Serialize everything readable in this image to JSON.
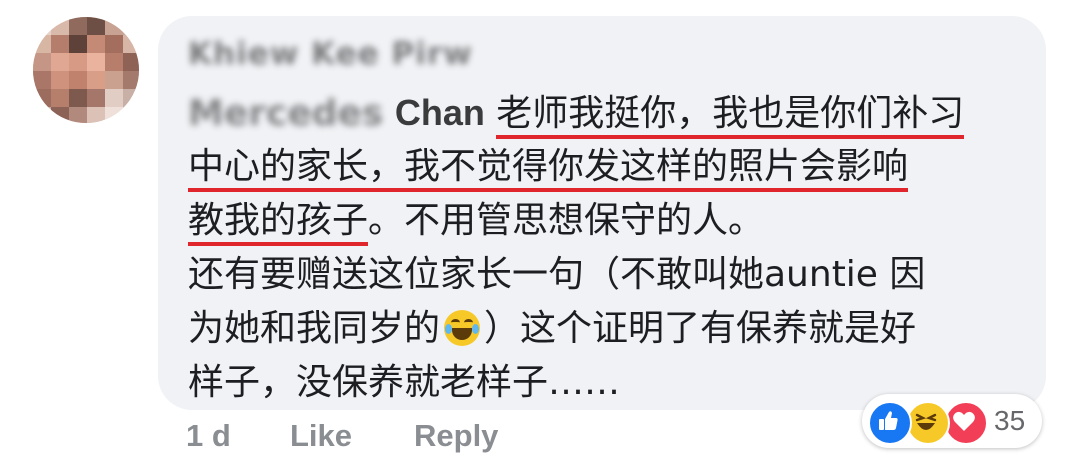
{
  "comment": {
    "author_name": "Khiew Kee Pirw",
    "mention_blurred": "Mercedes",
    "mention_name": "Chan",
    "lines": [
      {
        "underlined": "老师我挺你，我也是你们补习"
      },
      {
        "underlined": "中心的家长，我不觉得你发这样的照片会影响"
      },
      {
        "underlined": "教我的孩子",
        "plain": "。不用管思想保守的人。"
      },
      {
        "plain": "还有要赠送这位家长一句（不敢叫她auntie 因"
      },
      {
        "before": "为她和我同岁的",
        "after": "）这个证明了有保养就是好"
      },
      {
        "plain": "样子，没保养就老样子……"
      }
    ],
    "emoji": "face-with-tears-of-joy-icon",
    "underline_color": "#e0262c"
  },
  "actions": {
    "time": "1 d",
    "like": "Like",
    "reply": "Reply"
  },
  "reactions": {
    "icons": [
      "like-icon",
      "haha-icon",
      "love-icon"
    ],
    "count": "35"
  },
  "colors": {
    "bubble": "#f0f2f5",
    "like": "#1877f2",
    "haha": "#f7c928",
    "love": "#f33e58",
    "meta_text": "#8a8d91"
  }
}
